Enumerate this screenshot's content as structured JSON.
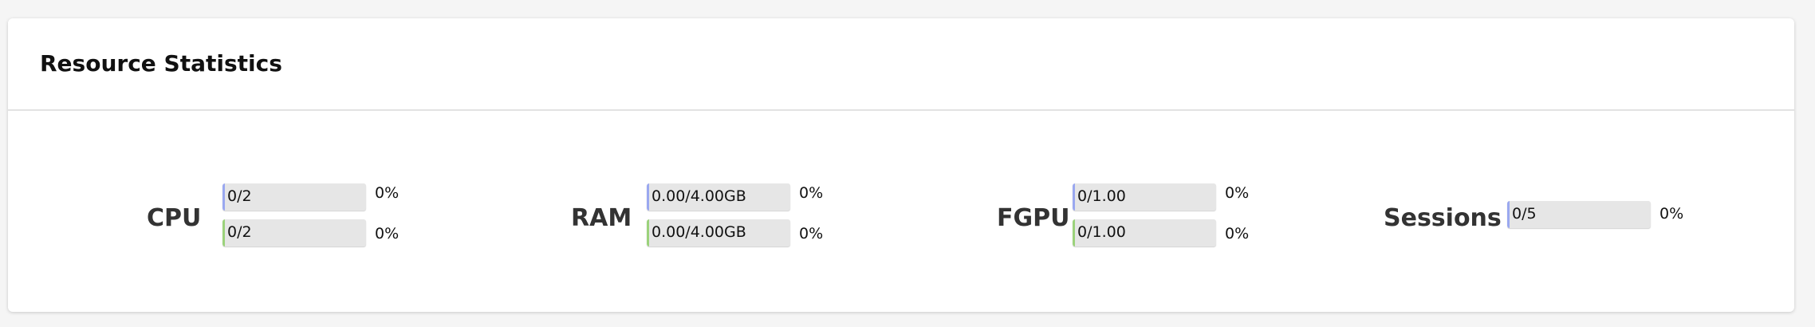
{
  "panel": {
    "title": "Resource Statistics"
  },
  "colors": {
    "bar_track": "#e6e6e6",
    "edge_top": "#9aa8f0",
    "edge_bottom": "#9bd27b"
  },
  "stats": [
    {
      "label": "CPU",
      "bars": [
        {
          "text": "0/2",
          "percent": "0%",
          "fill": 0
        },
        {
          "text": "0/2",
          "percent": "0%",
          "fill": 0
        }
      ]
    },
    {
      "label": "RAM",
      "bars": [
        {
          "text": "0.00/4.00GB",
          "percent": "0%",
          "fill": 0
        },
        {
          "text": "0.00/4.00GB",
          "percent": "0%",
          "fill": 0
        }
      ]
    },
    {
      "label": "FGPU",
      "bars": [
        {
          "text": "0/1.00",
          "percent": "0%",
          "fill": 0
        },
        {
          "text": "0/1.00",
          "percent": "0%",
          "fill": 0
        }
      ]
    },
    {
      "label": "Sessions",
      "bars": [
        {
          "text": "0/5",
          "percent": "0%",
          "fill": 0
        }
      ]
    }
  ]
}
